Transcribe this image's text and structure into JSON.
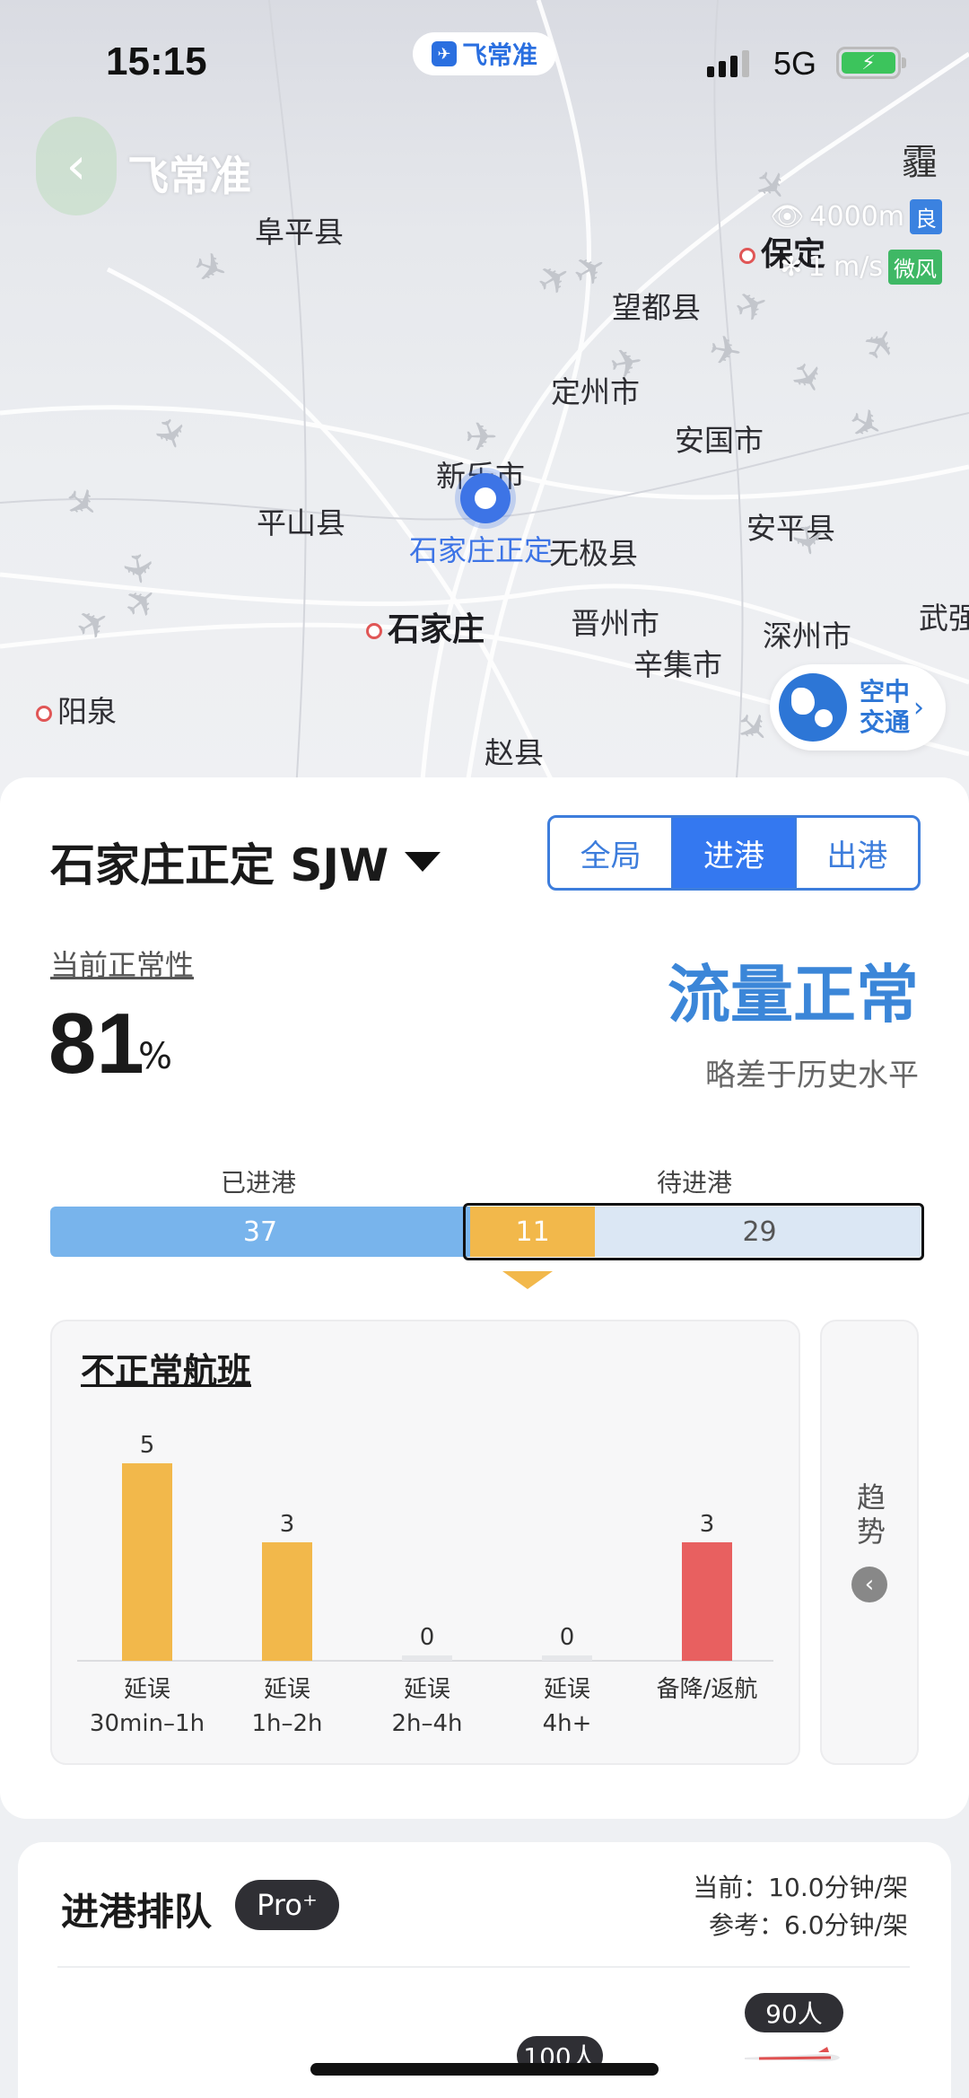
{
  "status_bar": {
    "time": "15:15",
    "network": "5G",
    "app_pill": "飞常准"
  },
  "header": {
    "back_icon": "chevron-left-icon",
    "title": "飞常准",
    "weather": "霾",
    "visibility": "4000m",
    "visibility_grade": "良",
    "wind": "1 m/s",
    "wind_grade": "微风"
  },
  "map": {
    "cities": [
      "阜平县",
      "保定",
      "望都县",
      "定州市",
      "安国市",
      "新乐市",
      "平山县",
      "无极县",
      "安平县",
      "晋州市",
      "深州市",
      "武强",
      "辛集市",
      "石家庄",
      "阳泉",
      "赵县"
    ],
    "selected_airport_label": "石家庄正定",
    "air_traffic_button": [
      "空中",
      "交通"
    ]
  },
  "airport": {
    "name": "石家庄正定 SJW"
  },
  "tabs": [
    {
      "label": "全局",
      "active": false
    },
    {
      "label": "进港",
      "active": true
    },
    {
      "label": "出港",
      "active": false
    }
  ],
  "punctuality": {
    "label": "当前正常性",
    "value": "81",
    "unit": "%"
  },
  "flow": {
    "status": "流量正常",
    "comparison": "略差于历史水平"
  },
  "arrivals": {
    "arrived_label": "已进港",
    "waiting_label": "待进港",
    "arrived": 37,
    "pending": 11,
    "waiting": 29,
    "arrived_text": "37",
    "pending_text": "11",
    "waiting_text": "29"
  },
  "abnormal": {
    "title": "不正常航班",
    "trend_label": "趋势"
  },
  "chart_data": {
    "type": "bar",
    "categories": [
      [
        "延误",
        "30min–1h"
      ],
      [
        "延误",
        "1h–2h"
      ],
      [
        "延误",
        "2h–4h"
      ],
      [
        "延误",
        "4h+"
      ],
      [
        "备降/返航"
      ]
    ],
    "values": [
      5,
      3,
      0,
      0,
      3
    ],
    "colors": [
      "#f2b84b",
      "#f2b84b",
      "#f2b84b",
      "#f2b84b",
      "#e86060"
    ],
    "ylim": [
      0,
      5
    ]
  },
  "queue": {
    "title": "进港排队",
    "pro_badge": "Pro⁺",
    "current": "当前：10.0分钟/架",
    "reference": "参考：6.0分钟/架",
    "bubble_1": "100人",
    "bubble_2": "90人"
  }
}
